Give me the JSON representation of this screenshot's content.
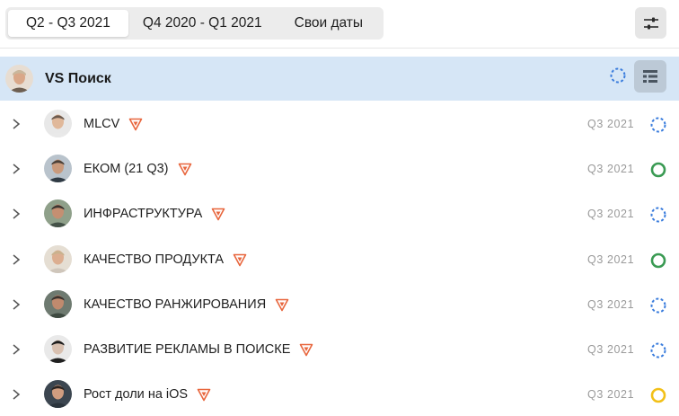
{
  "tabs": [
    {
      "label": "Q2 - Q3 2021",
      "active": true
    },
    {
      "label": "Q4 2020 - Q1 2021",
      "active": false
    },
    {
      "label": "Свои даты",
      "active": false
    }
  ],
  "toolbar": {
    "settings_icon": "sliders-icon"
  },
  "group": {
    "title": "VS Поиск",
    "status_icon": "dashed-circle-icon",
    "view_icon": "list-view-icon",
    "highlight_color": "#d6e6f6"
  },
  "rows": [
    {
      "title": "MLCV",
      "period": "Q3 2021",
      "status": "dashed"
    },
    {
      "title": "ЕКОМ (21 Q3)",
      "period": "Q3 2021",
      "status": "green"
    },
    {
      "title": "ИНФРАСТРУКТУРА",
      "period": "Q3 2021",
      "status": "dashed"
    },
    {
      "title": "КАЧЕСТВО ПРОДУКТА",
      "period": "Q3 2021",
      "status": "green"
    },
    {
      "title": "КАЧЕСТВО РАНЖИРОВАНИЯ",
      "period": "Q3 2021",
      "status": "dashed"
    },
    {
      "title": "РАЗВИТИЕ РЕКЛАМЫ В ПОИСКЕ",
      "period": "Q3 2021",
      "status": "dashed"
    },
    {
      "title": "Рост доли на iOS",
      "period": "Q3 2021",
      "status": "yellow"
    }
  ],
  "colors": {
    "status_dashed": "#3b7ddd",
    "status_green": "#3a9a53",
    "status_yellow": "#f2c018",
    "goal_icon": "#e8663d"
  }
}
